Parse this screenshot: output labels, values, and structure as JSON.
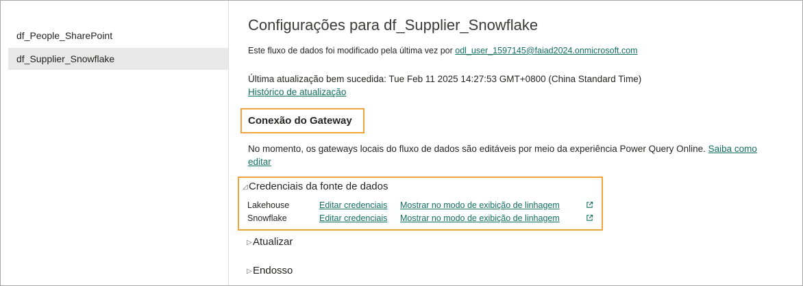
{
  "sidebar": {
    "items": [
      {
        "label": "df_People_SharePoint",
        "selected": false
      },
      {
        "label": "df_Supplier_Snowflake",
        "selected": true
      }
    ]
  },
  "main": {
    "title": "Configurações para df_Supplier_Snowflake",
    "modified_text": "Este fluxo de dados foi modificado pela última vez por",
    "modified_user": "odl_user_1597145@faiad2024.onmicrosoft.com",
    "last_refresh": "Última atualização bem sucedida: Tue Feb 11 2025 14:27:53 GMT+0800 (China Standard Time)",
    "history_link": "Histórico de atualização",
    "gateway": {
      "title": "Conexão do Gateway",
      "note": "No momento, os gateways locais do fluxo de dados são editáveis por meio da experiência Power Query Online.",
      "learn_more": "Saiba como editar"
    },
    "credentials": {
      "title": "Credenciais da fonte de dados",
      "expanded": true,
      "rows": [
        {
          "source": "Lakehouse",
          "edit_label": "Editar credenciais",
          "lineage_label": "Mostrar no modo de exibição de linhagem"
        },
        {
          "source": "Snowflake",
          "edit_label": "Editar credenciais",
          "lineage_label": "Mostrar no modo de exibição de linhagem"
        }
      ]
    },
    "refresh_section": {
      "title": "Atualizar",
      "expanded": false
    },
    "endorsement_section": {
      "title": "Endosso",
      "expanded": false
    }
  },
  "icons": {
    "expanded": "triangle-expanded-icon",
    "collapsed": "triangle-collapsed-icon",
    "external": "external-link-icon"
  },
  "colors": {
    "link": "#0f6f5f",
    "highlight_border": "#f2a23a",
    "selected_bg": "#e8e8e8"
  }
}
